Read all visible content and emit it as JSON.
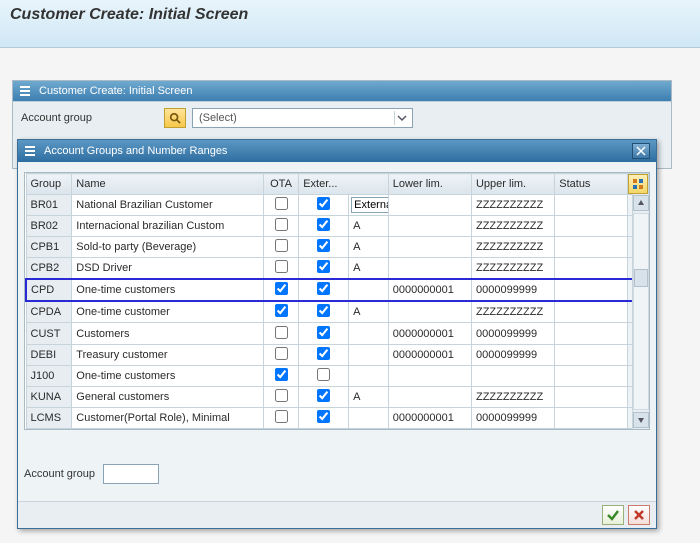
{
  "page": {
    "title": "Customer Create: Initial Screen"
  },
  "behind_panel": {
    "title": "Customer Create: Initial Screen",
    "field_label": "Account group",
    "select_placeholder": "(Select)"
  },
  "dialog": {
    "title": "Account Groups and Number Ranges",
    "close_icon": "close-icon",
    "columns": {
      "group": "Group",
      "name": "Name",
      "ota": "OTA",
      "extern": "Exter...",
      "lower": "Lower lim.",
      "upper": "Upper lim.",
      "status": "Status"
    },
    "rows": [
      {
        "group": "BR01",
        "name": "National  Brazilian Customer",
        "ota": false,
        "extern": true,
        "ext_text": "External",
        "show_ext_input": true,
        "lower": "",
        "upper": "ZZZZZZZZZZ",
        "status": "",
        "selected": false
      },
      {
        "group": "BR02",
        "name": "Internacional brazilian Custom",
        "ota": false,
        "extern": true,
        "ext_text": "A",
        "lower": "",
        "upper": "ZZZZZZZZZZ",
        "status": "",
        "selected": false
      },
      {
        "group": "CPB1",
        "name": "Sold-to party (Beverage)",
        "ota": false,
        "extern": true,
        "ext_text": "A",
        "lower": "",
        "upper": "ZZZZZZZZZZ",
        "status": "",
        "selected": false
      },
      {
        "group": "CPB2",
        "name": "DSD Driver",
        "ota": false,
        "extern": true,
        "ext_text": "A",
        "lower": "",
        "upper": "ZZZZZZZZZZ",
        "status": "",
        "selected": false
      },
      {
        "group": "CPD",
        "name": "One-time customers",
        "ota": true,
        "extern": true,
        "ext_text": "",
        "lower": "0000000001",
        "upper": "0000099999",
        "status": "",
        "selected": true
      },
      {
        "group": "CPDA",
        "name": "One-time customer",
        "ota": true,
        "extern": true,
        "ext_text": "A",
        "lower": "",
        "upper": "ZZZZZZZZZZ",
        "status": "",
        "selected": false
      },
      {
        "group": "CUST",
        "name": "Customers",
        "ota": false,
        "extern": true,
        "ext_text": "",
        "lower": "0000000001",
        "upper": "0000099999",
        "status": "",
        "selected": false
      },
      {
        "group": "DEBI",
        "name": "Treasury customer",
        "ota": false,
        "extern": true,
        "ext_text": "",
        "lower": "0000000001",
        "upper": "0000099999",
        "status": "",
        "selected": false
      },
      {
        "group": "J100",
        "name": "One-time customers",
        "ota": true,
        "extern": false,
        "ext_text": "",
        "lower": "",
        "upper": "",
        "status": "",
        "selected": false
      },
      {
        "group": "KUNA",
        "name": "General customers",
        "ota": false,
        "extern": true,
        "ext_text": "A",
        "lower": "",
        "upper": "ZZZZZZZZZZ",
        "status": "",
        "selected": false
      },
      {
        "group": "LCMS",
        "name": "Customer(Portal Role), Minimal",
        "ota": false,
        "extern": true,
        "ext_text": "",
        "lower": "0000000001",
        "upper": "0000099999",
        "status": "",
        "selected": false
      }
    ],
    "footer_field_label": "Account group",
    "confirm_icon": "check",
    "cancel_icon": "cross"
  }
}
